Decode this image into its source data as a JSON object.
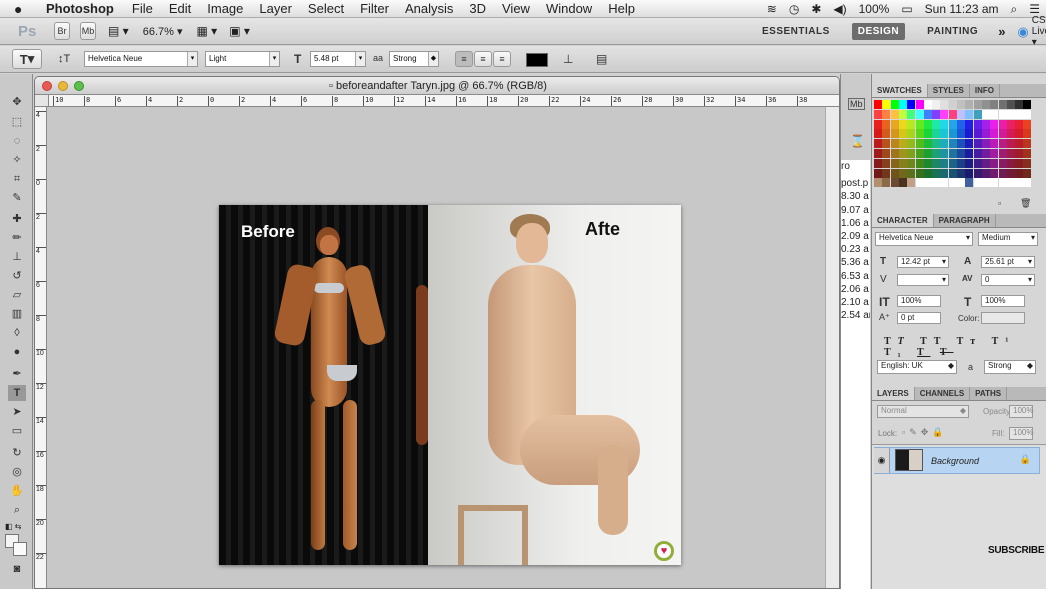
{
  "menubar": {
    "apple": "",
    "app_name": "Photoshop",
    "items": [
      "File",
      "Edit",
      "Image",
      "Layer",
      "Select",
      "Filter",
      "Analysis",
      "3D",
      "View",
      "Window",
      "Help"
    ],
    "battery": "100%",
    "clock": "Sun 11:23 am"
  },
  "appbar": {
    "ps_logo": "Ps",
    "br_label": "Br",
    "mb_label": "Mb",
    "zoom": "66.7%",
    "workspaces": [
      "ESSENTIALS",
      "DESIGN",
      "PAINTING"
    ],
    "active_workspace": "DESIGN",
    "more": "»",
    "cs_live": "CS Live"
  },
  "options": {
    "tool_glyph": "T",
    "font_family": "Helvetica Neue",
    "font_style": "Light",
    "size": "5.48 pt",
    "aa_label": "a",
    "antialias": "Strong",
    "text_color": "#000000"
  },
  "document": {
    "title": "beforeandafter Taryn.jpg @ 66.7% (RGB/8)",
    "ruler_labels": [
      "10",
      "8",
      "6",
      "4",
      "2",
      "0",
      "2",
      "4",
      "6",
      "8",
      "10",
      "12",
      "14",
      "16",
      "18",
      "20",
      "22",
      "24",
      "26",
      "28",
      "30",
      "32",
      "34",
      "36",
      "38"
    ],
    "vruler_labels": [
      "4",
      "2",
      "0",
      "2",
      "4",
      "6",
      "8",
      "10",
      "12",
      "14",
      "16",
      "18",
      "20",
      "22"
    ],
    "photo_before": "Before",
    "photo_after": "Afte"
  },
  "peek_text": [
    "ro",
    "",
    "post.p",
    "8.30 a",
    "9.07 a",
    "1.06 a",
    "2.09 a",
    "0.23 a",
    "5.36 a",
    "6.53 a",
    "2.06 a",
    "2.10 a",
    "2.54 ar"
  ],
  "panels": {
    "swatch_tabs": [
      "SWATCHES",
      "STYLES",
      "INFO"
    ],
    "character_tabs": [
      "CHARACTER",
      "PARAGRAPH"
    ],
    "char_font": "Helvetica Neue",
    "char_style": "Medium",
    "char_size": "12.42 pt",
    "char_leading": "25.61 pt",
    "char_kerning": "",
    "char_tracking": "0",
    "char_vscale": "100%",
    "char_hscale": "100%",
    "char_baseline": "0 pt",
    "color_label": "Color:",
    "language": "English: UK",
    "antialias": "Strong",
    "layers_tabs": [
      "LAYERS",
      "CHANNELS",
      "PATHS"
    ],
    "blend_mode": "Normal",
    "opacity_label": "Opacity:",
    "opacity": "100%",
    "lock_label": "Lock:",
    "fill_label": "Fill:",
    "fill": "100%",
    "layer_name": "Background"
  },
  "overlay": {
    "subscribe": "SUBSCRIBE"
  },
  "colors": {
    "accent": "#3a88d8",
    "layer_highlight": "#b8d4f3"
  }
}
